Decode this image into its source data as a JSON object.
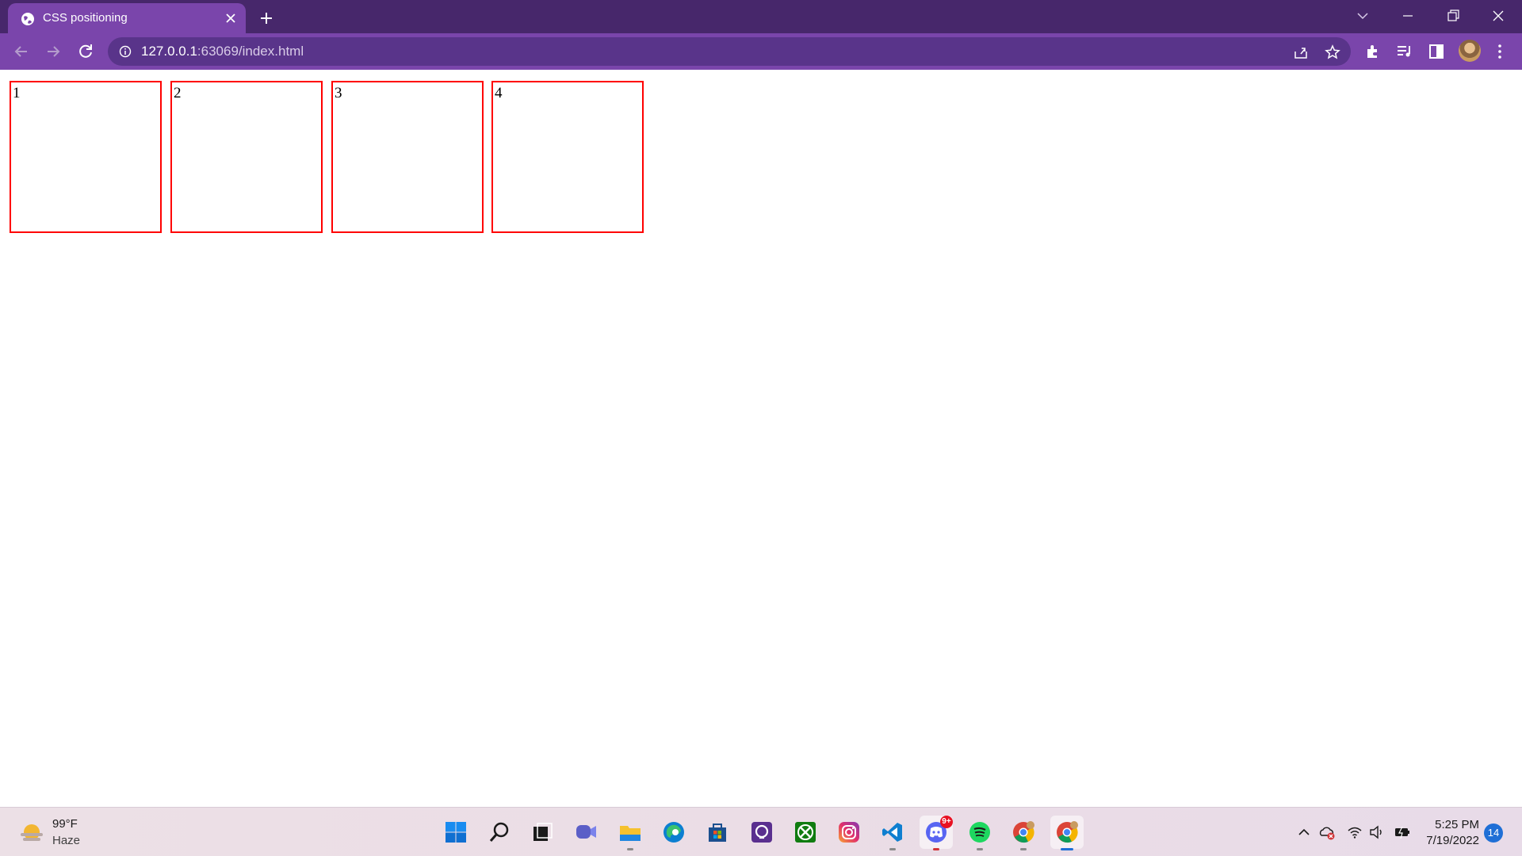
{
  "browser": {
    "tab": {
      "title": "CSS positioning",
      "favicon": "globe-icon"
    },
    "address": {
      "host": "127.0.0.1",
      "rest": ":63069/index.html"
    },
    "accent": "#7a45ab",
    "frame_color": "#47276b"
  },
  "page": {
    "boxes": [
      {
        "label": "1"
      },
      {
        "label": "2"
      },
      {
        "label": "3"
      },
      {
        "label": "4"
      }
    ],
    "box_border_color": "#ff0000"
  },
  "taskbar": {
    "weather": {
      "temp": "99°F",
      "condition": "Haze"
    },
    "apps": [
      {
        "name": "windows-start-icon"
      },
      {
        "name": "search-icon"
      },
      {
        "name": "task-view-icon"
      },
      {
        "name": "teams-chat-icon"
      },
      {
        "name": "file-explorer-icon"
      },
      {
        "name": "edge-icon"
      },
      {
        "name": "microsoft-store-icon"
      },
      {
        "name": "proton-vpn-icon"
      },
      {
        "name": "xbox-icon"
      },
      {
        "name": "instagram-icon"
      },
      {
        "name": "vscode-icon"
      },
      {
        "name": "discord-icon",
        "badge": "9+"
      },
      {
        "name": "spotify-icon"
      },
      {
        "name": "chrome-icon"
      },
      {
        "name": "chrome-icon"
      }
    ],
    "clock": {
      "time": "5:25 PM",
      "date": "7/19/2022"
    },
    "notification_count": "14"
  }
}
